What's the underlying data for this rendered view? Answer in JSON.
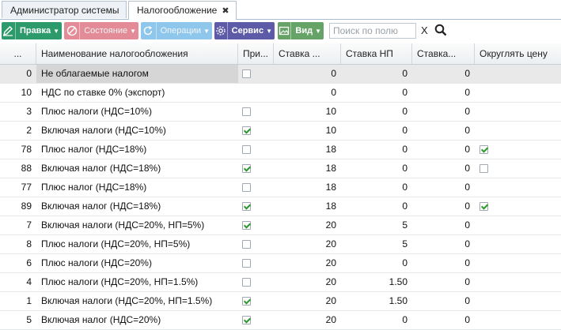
{
  "tabs": [
    {
      "label": "Администратор системы"
    },
    {
      "label": "Налогообложение",
      "close": "✖"
    }
  ],
  "toolbar": {
    "edit": {
      "label": "Правка",
      "color": "#2c9a6a"
    },
    "state": {
      "label": "Состояние",
      "color": "#e38b96"
    },
    "operations": {
      "label": "Операции",
      "color": "#8fc7ec"
    },
    "service": {
      "label": "Сервис",
      "color": "#5d5aa8"
    },
    "view": {
      "label": "Вид",
      "color": "#66a366"
    },
    "search_placeholder": "Поиск по полю",
    "clear": "X"
  },
  "columns": [
    "...",
    "Наименование налогообложения",
    "При...",
    "Ставка ...",
    "Ставка НП",
    "Ставка...",
    "Округлять цену"
  ],
  "rows": [
    {
      "id": "0",
      "name": "Не облагаемые налогом",
      "inc": false,
      "r1": "0",
      "r2": "0",
      "r3": "0",
      "round": null
    },
    {
      "id": "10",
      "name": "НДС по ставке 0% (экспорт)",
      "inc": null,
      "r1": "0",
      "r2": "0",
      "r3": "0",
      "round": null
    },
    {
      "id": "3",
      "name": "Плюс налоги (НДС=10%)",
      "inc": false,
      "r1": "10",
      "r2": "0",
      "r3": "0",
      "round": null
    },
    {
      "id": "2",
      "name": "Включая налоги (НДС=10%)",
      "inc": true,
      "r1": "10",
      "r2": "0",
      "r3": "0",
      "round": null
    },
    {
      "id": "78",
      "name": "Плюс налог (НДС=18%)",
      "inc": false,
      "r1": "18",
      "r2": "0",
      "r3": "0",
      "round": true
    },
    {
      "id": "88",
      "name": "Включая налог (НДС=18%)",
      "inc": true,
      "r1": "18",
      "r2": "0",
      "r3": "0",
      "round": false
    },
    {
      "id": "77",
      "name": "Плюс налог (НДС=18%)",
      "inc": false,
      "r1": "18",
      "r2": "0",
      "r3": "0",
      "round": null
    },
    {
      "id": "89",
      "name": "Включая налог (НДС=18%)",
      "inc": true,
      "r1": "18",
      "r2": "0",
      "r3": "0",
      "round": true
    },
    {
      "id": "7",
      "name": "Включая налоги (НДС=20%, НП=5%)",
      "inc": true,
      "r1": "20",
      "r2": "5",
      "r3": "0",
      "round": null
    },
    {
      "id": "8",
      "name": "Плюс налоги (НДС=20%, НП=5%)",
      "inc": false,
      "r1": "20",
      "r2": "5",
      "r3": "0",
      "round": null
    },
    {
      "id": "6",
      "name": "Плюс налоги (НДС=20%)",
      "inc": false,
      "r1": "20",
      "r2": "0",
      "r3": "0",
      "round": null
    },
    {
      "id": "4",
      "name": "Плюс налоги (НДС=20%, НП=1.5%)",
      "inc": false,
      "r1": "20",
      "r2": "1.50",
      "r3": "0",
      "round": null
    },
    {
      "id": "1",
      "name": "Включая налоги (НДС=20%, НП=1.5%)",
      "inc": true,
      "r1": "20",
      "r2": "1.50",
      "r3": "0",
      "round": null
    },
    {
      "id": "5",
      "name": "Включая налог (НДС=20%)",
      "inc": true,
      "r1": "20",
      "r2": "0",
      "r3": "0",
      "round": null
    }
  ]
}
